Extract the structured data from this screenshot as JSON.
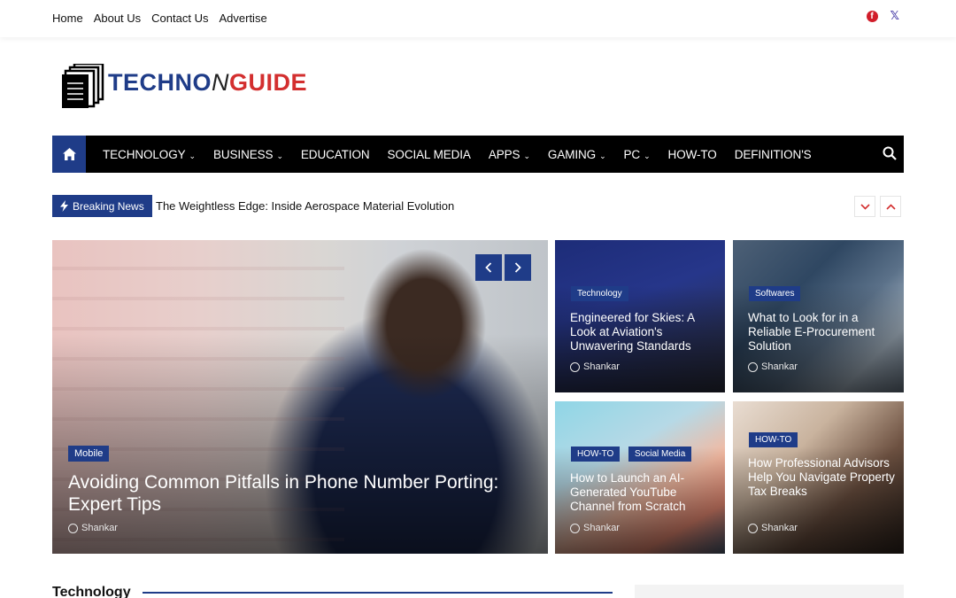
{
  "top_nav": [
    "Home",
    "About Us",
    "Contact Us",
    "Advertise"
  ],
  "social": {
    "facebook": "facebook-icon",
    "x": "x-icon"
  },
  "logo": {
    "part1": "TECHNO",
    "part2": "N",
    "part3": "GUIDE"
  },
  "main_nav": [
    {
      "label": "TECHNOLOGY",
      "dropdown": true
    },
    {
      "label": "BUSINESS",
      "dropdown": true
    },
    {
      "label": "EDUCATION",
      "dropdown": false
    },
    {
      "label": "SOCIAL MEDIA",
      "dropdown": false
    },
    {
      "label": "APPS",
      "dropdown": true
    },
    {
      "label": "GAMING",
      "dropdown": true
    },
    {
      "label": "PC",
      "dropdown": true
    },
    {
      "label": "HOW-TO",
      "dropdown": false
    },
    {
      "label": "DEFINITION'S",
      "dropdown": false
    }
  ],
  "breaking": {
    "label": "Breaking News",
    "headline": "The Weightless Edge: Inside Aerospace Material Evolution"
  },
  "hero": {
    "badge": "Mobile",
    "title": "Avoiding Common Pitfalls in Phone Number Porting: Expert Tips",
    "author": "Shankar"
  },
  "side_cards": [
    {
      "badges": [
        "Technology"
      ],
      "title": "Engineered for Skies: A Look at Aviation's Unwavering Standards",
      "author": "Shankar"
    },
    {
      "badges": [
        "Softwares"
      ],
      "title": "What to Look for in a Reliable E-Procurement Solution",
      "author": "Shankar"
    },
    {
      "badges": [
        "HOW-TO",
        "Social Media"
      ],
      "title": "How to Launch an AI-Generated YouTube Channel from Scratch",
      "author": "Shankar"
    },
    {
      "badges": [
        "HOW-TO"
      ],
      "title": "How Professional Advisors Help You Navigate Property Tax Breaks",
      "author": "Shankar"
    }
  ],
  "section": {
    "title": "Technology"
  },
  "colors": {
    "brand_blue": "#1f3c88",
    "accent_red": "#d32f2f",
    "nav_bg": "#000000"
  }
}
